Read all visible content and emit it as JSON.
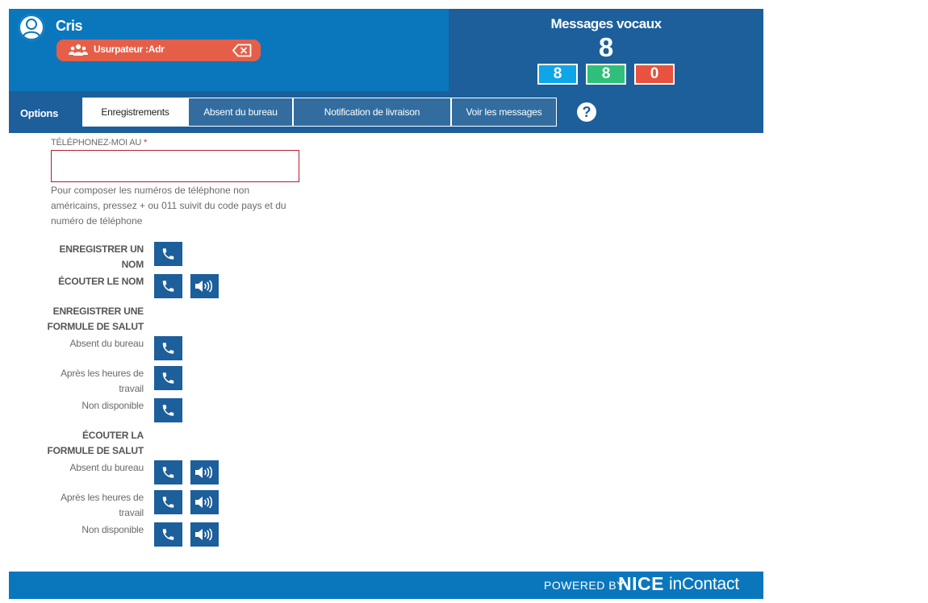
{
  "header": {
    "user_name": "Cris",
    "impersonation_label": "Usurpateur :Adr"
  },
  "voicemail": {
    "title": "Messages vocaux",
    "total": "8",
    "counts": [
      "8",
      "8",
      "0"
    ],
    "count_colors": [
      "#0ea5e9",
      "#2ec07a",
      "#e8523e"
    ]
  },
  "tabs": {
    "options_label": "Options",
    "items": [
      {
        "label": "Enregistrements",
        "active": true
      },
      {
        "label": "Absent du bureau",
        "active": false
      },
      {
        "label": "Notification de livraison",
        "active": false
      },
      {
        "label": "Voir les messages",
        "active": false
      }
    ],
    "help_glyph": "?"
  },
  "form": {
    "phone_label": "TÉLÉPHONEZ-MOI AU",
    "required_mark": "*",
    "phone_value": "",
    "help_text": "Pour composer les numéros de téléphone non américains, pressez + ou 011 suivit du code pays et du numéro de téléphone"
  },
  "sections": {
    "record_name": "ENREGISTRER UN NOM",
    "listen_name": "ÉCOUTER LE NOM",
    "record_greeting": "ENREGISTRER UNE FORMULE DE SALUT",
    "listen_greeting": "ÉCOUTER LA FORMULE DE SALUT"
  },
  "greeting_types": {
    "out_of_office": "Absent du bureau",
    "after_hours": "Après les heures de travail",
    "unavailable": "Non disponible"
  },
  "footer": {
    "powered_by": "POWERED BY",
    "brand_nice": "NICE",
    "brand_incontact": "inContact"
  },
  "colors": {
    "header_blue": "#0a77bd",
    "dark_blue": "#1c5f9b",
    "impersonation_red": "#e55f48"
  }
}
